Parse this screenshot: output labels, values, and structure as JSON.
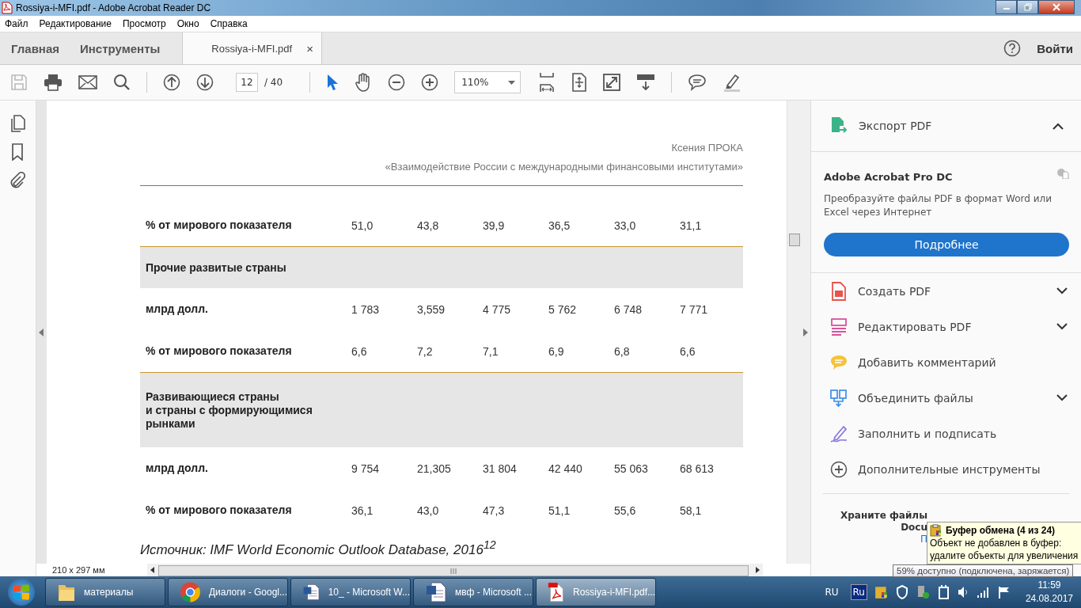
{
  "window": {
    "title": "Rossiya-i-MFI.pdf - Adobe Acrobat Reader DC"
  },
  "menu": [
    "Файл",
    "Редактирование",
    "Просмотр",
    "Окно",
    "Справка"
  ],
  "tabs": [
    {
      "label": "Главная",
      "selected": false,
      "kind": "nav"
    },
    {
      "label": "Инструменты",
      "selected": false,
      "kind": "nav"
    },
    {
      "label": "Rossiya-i-MFI.pdf",
      "selected": true,
      "kind": "document"
    }
  ],
  "tab_close": "×",
  "sign_in": "Войти",
  "toolbar": {
    "save_disabled": true,
    "page": "12",
    "pages": "/ 40",
    "modes": [
      {
        "kind": "select",
        "selected": true
      },
      {
        "kind": "hand",
        "selected": false
      }
    ],
    "zoom": "110%"
  },
  "document": {
    "author": "Ксения ПРОКА",
    "title": "«Взаимодействие России с международными финансовыми институтами»",
    "rows": [
      {
        "kind": "data",
        "label": "% от мирового показателя",
        "values": [
          "51,0",
          "43,8",
          "39,9",
          "36,5",
          "33,0",
          "31,1"
        ]
      },
      {
        "kind": "section",
        "label": "Прочие развитые страны",
        "values": []
      },
      {
        "kind": "data",
        "label": "млрд долл.",
        "values": [
          "1 783",
          "3,559",
          "4 775",
          "5 762",
          "6 748",
          "7 771"
        ]
      },
      {
        "kind": "data",
        "label": "% от мирового показателя",
        "values": [
          "6,6",
          "7,2",
          "7,1",
          "6,9",
          "6,8",
          "6,6"
        ]
      },
      {
        "kind": "section",
        "label": "Развивающиеся страны\nи страны с формирующимися\nрынками",
        "values": []
      },
      {
        "kind": "data",
        "label": "млрд долл.",
        "values": [
          "9 754",
          "21,305",
          "31 804",
          "42 440",
          "55 063",
          "68 613"
        ]
      },
      {
        "kind": "data",
        "label": "% от мирового показателя",
        "values": [
          "36,1",
          "43,0",
          "47,3",
          "51,1",
          "55,6",
          "58,1"
        ]
      }
    ],
    "source": "Источник: IMF World Economic Outlook Database, 2016$^{12}$",
    "page_size": "210 x 297 мм"
  },
  "panel": {
    "export": {
      "label": "Экспорт PDF",
      "expanded": true
    },
    "product": "Adobe Acrobat Pro DC",
    "description": "Преобразуйте файлы PDF в формат Word или Excel через Интернет",
    "button": "Подробнее",
    "tools": [
      {
        "kind": "create",
        "label": "Создать PDF",
        "expandable": true
      },
      {
        "kind": "edit",
        "label": "Редактировать PDF",
        "expandable": true
      },
      {
        "kind": "comment",
        "label": "Добавить комментарий",
        "expandable": false
      },
      {
        "kind": "combine",
        "label": "Объединить файлы",
        "expandable": true
      },
      {
        "kind": "sign",
        "label": "Заполнить и подписать",
        "expandable": false
      },
      {
        "kind": "more",
        "label": "Дополнительные инструменты",
        "expandable": false
      }
    ],
    "storage": [
      "Храните файлы",
      "Docu"
    ],
    "storage_link": "П"
  },
  "clipboard_tooltip": {
    "title": "Буфер обмена (4 из 24)",
    "lines": [
      "Объект не добавлен в буфер:",
      "удалите объекты для увеличения"
    ]
  },
  "battery_tooltip": "59% доступно (подключена, заряжается)",
  "taskbar": {
    "items": [
      {
        "kind": "folder",
        "label": "материалы",
        "selected": false
      },
      {
        "kind": "chrome",
        "label": "Диалоги - Googl...",
        "selected": false
      },
      {
        "kind": "word",
        "label": "10_ - Microsoft W...",
        "selected": false
      },
      {
        "kind": "word",
        "label": "мвф - Microsoft ...",
        "selected": false
      },
      {
        "kind": "pdf",
        "label": "Rossiya-i-MFI.pdf...",
        "selected": true
      }
    ],
    "lang": "RU",
    "ime": "Ru",
    "time": "11:59",
    "date": "24.08.2017"
  }
}
